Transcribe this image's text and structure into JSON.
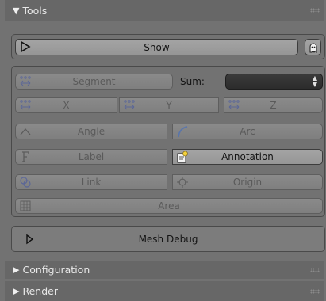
{
  "tools_panel": {
    "title": "Tools"
  },
  "show_row": {
    "show_label": "Show"
  },
  "measure": {
    "segment_label": "Segment",
    "sum_label": "Sum:",
    "sum_value": "-",
    "x_label": "X",
    "y_label": "Y",
    "z_label": "Z",
    "angle_label": "Angle",
    "arc_label": "Arc",
    "label_label": "Label",
    "annotation_label": "Annotation",
    "link_label": "Link",
    "origin_label": "Origin",
    "area_label": "Area"
  },
  "mesh_debug": {
    "label": "Mesh Debug"
  },
  "configuration_panel": {
    "title": "Configuration"
  },
  "render_panel": {
    "title": "Render"
  },
  "colors": {
    "panel_bg": "#727272",
    "header_bg": "#676767",
    "button_bg": "#9e9e9e",
    "select_bg": "#303030",
    "annotation_icon": "#f4d23c"
  }
}
